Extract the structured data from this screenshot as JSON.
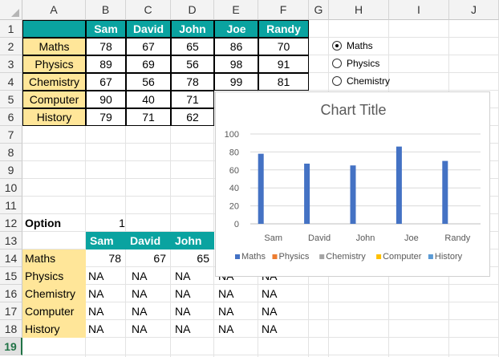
{
  "columns": [
    "A",
    "B",
    "C",
    "D",
    "E",
    "F",
    "G",
    "H",
    "I",
    "J"
  ],
  "rows": [
    "1",
    "2",
    "3",
    "4",
    "5",
    "6",
    "7",
    "8",
    "9",
    "10",
    "11",
    "12",
    "13",
    "14",
    "15",
    "16",
    "17",
    "18",
    "19"
  ],
  "selected_row": "19",
  "table": {
    "headers": [
      "Sam",
      "David",
      "John",
      "Joe",
      "Randy"
    ],
    "subjects": [
      "Maths",
      "Physics",
      "Chemistry",
      "Computer",
      "History"
    ],
    "values": [
      [
        "78",
        "67",
        "65",
        "86",
        "70"
      ],
      [
        "89",
        "69",
        "56",
        "98",
        "91"
      ],
      [
        "67",
        "56",
        "78",
        "99",
        "81"
      ],
      [
        "90",
        "40",
        "71",
        "",
        ""
      ],
      [
        "79",
        "71",
        "62",
        "",
        ""
      ]
    ]
  },
  "radio_options": [
    {
      "label": "Maths",
      "selected": true
    },
    {
      "label": "Physics",
      "selected": false
    },
    {
      "label": "Chemistry",
      "selected": false
    }
  ],
  "option_label": "Option",
  "option_value": "1",
  "lower": {
    "headers": [
      "Sam",
      "David",
      "John"
    ],
    "subjects": [
      "Maths",
      "Physics",
      "Chemistry",
      "Computer",
      "History"
    ],
    "values": [
      [
        "78",
        "67",
        "65",
        "",
        ""
      ],
      [
        "NA",
        "NA",
        "NA",
        "NA",
        "NA"
      ],
      [
        "NA",
        "NA",
        "NA",
        "NA",
        "NA"
      ],
      [
        "NA",
        "NA",
        "NA",
        "NA",
        "NA"
      ],
      [
        "NA",
        "NA",
        "NA",
        "NA",
        "NA"
      ]
    ]
  },
  "colors": {
    "teal": "#0aa3a0",
    "peach": "#ffe699",
    "maths": "#4472c4",
    "physics": "#ed7d31",
    "chemistry": "#a5a5a5",
    "computer": "#ffc000",
    "history": "#5b9bd5"
  },
  "chart_data": {
    "type": "bar",
    "title": "Chart Title",
    "categories": [
      "Sam",
      "David",
      "John",
      "Joe",
      "Randy"
    ],
    "series": [
      {
        "name": "Maths",
        "values": [
          78,
          67,
          65,
          86,
          70
        ]
      },
      {
        "name": "Physics",
        "values": [
          null,
          null,
          null,
          null,
          null
        ]
      },
      {
        "name": "Chemistry",
        "values": [
          null,
          null,
          null,
          null,
          null
        ]
      },
      {
        "name": "Computer",
        "values": [
          null,
          null,
          null,
          null,
          null
        ]
      },
      {
        "name": "History",
        "values": [
          null,
          null,
          null,
          null,
          null
        ]
      }
    ],
    "ylim": [
      0,
      100
    ],
    "yticks": [
      0,
      20,
      40,
      60,
      80,
      100
    ],
    "grid": true,
    "legend": "bottom"
  }
}
